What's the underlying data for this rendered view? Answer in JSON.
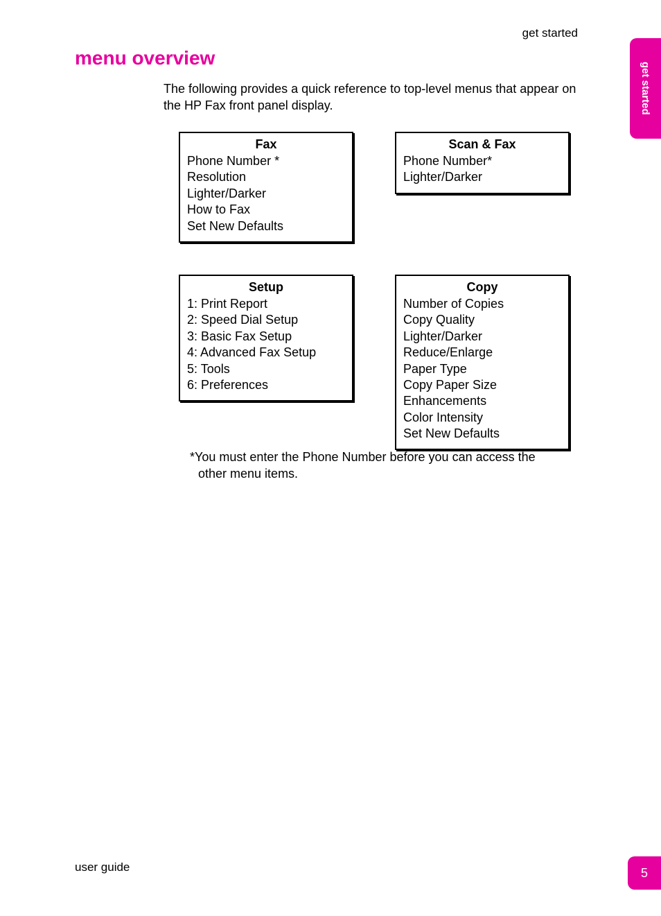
{
  "header": {
    "chapter": "get started"
  },
  "sideTab": "get started",
  "title": "menu overview",
  "intro": "The following provides a quick reference to top-level menus that appear on the HP Fax front panel display.",
  "menus": {
    "fax": {
      "title": "Fax",
      "items": [
        "Phone Number *",
        "Resolution",
        "Lighter/Darker",
        "How to Fax",
        "Set New Defaults"
      ]
    },
    "scanfax": {
      "title": "Scan & Fax",
      "items": [
        "Phone Number*",
        "Lighter/Darker"
      ]
    },
    "setup": {
      "title": "Setup",
      "items": [
        "1: Print Report",
        "2: Speed Dial Setup",
        "3: Basic Fax Setup",
        "4: Advanced Fax Setup",
        "5: Tools",
        "6: Preferences"
      ]
    },
    "copy": {
      "title": "Copy",
      "items": [
        "Number of Copies",
        "Copy Quality",
        "Lighter/Darker",
        "Reduce/Enlarge",
        "Paper Type",
        "Copy Paper Size",
        "Enhancements",
        "Color Intensity",
        "Set New Defaults"
      ]
    }
  },
  "footnote": "*You must enter the Phone Number before you can access the other menu items.",
  "footer": {
    "left": "user guide",
    "pageNumber": "5"
  }
}
